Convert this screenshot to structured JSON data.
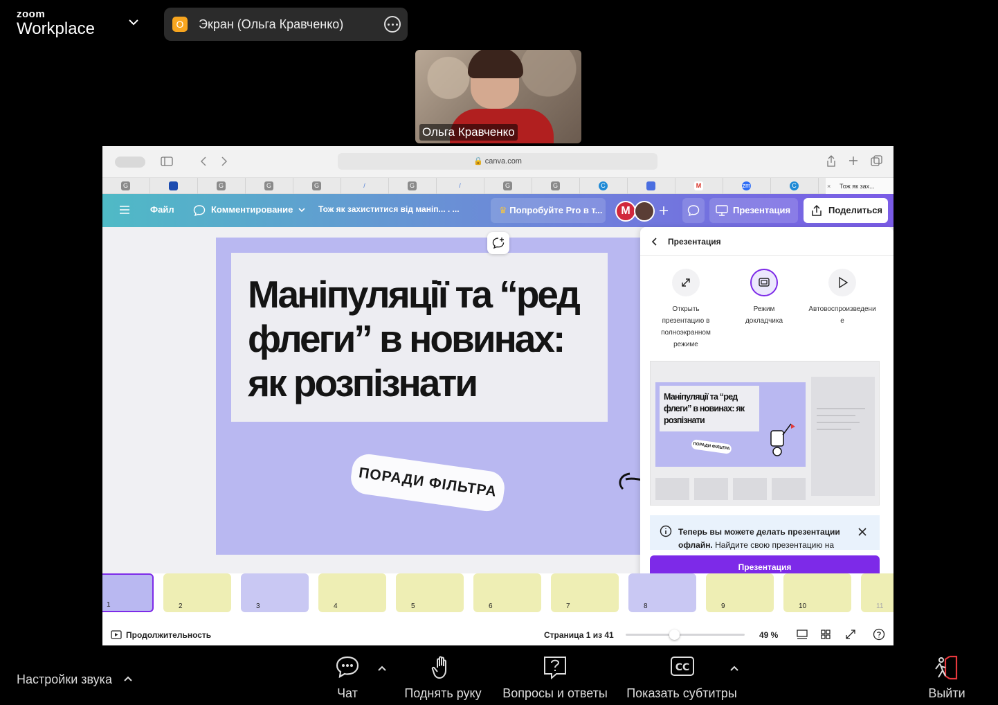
{
  "zoom": {
    "brand_small": "zoom",
    "brand_big": "Workplace",
    "share_badge": "O",
    "share_label": "Экран (Ольга Кравченко)",
    "participant_name": "Ольга Кравченко"
  },
  "browser": {
    "url": "canva.com",
    "tabs": [
      "G",
      "",
      "G",
      "G",
      "G",
      "/",
      "G",
      "/",
      "G",
      "G",
      "C",
      "",
      "M",
      "zm",
      "C"
    ],
    "last_tab_title": "Тож як зах..."
  },
  "canva": {
    "menu_file": "Файл",
    "commenting": "Комментирование",
    "doc_title": "Тож як захиститися від маніп... . ...",
    "pro_promo": "Попробуйте Pro в т...",
    "avatar_letter": "M",
    "present_button": "Презентация",
    "share_button": "Поделиться",
    "slide": {
      "title": "Маніпуляції та “ред флеги” в новинах: як розпізнати",
      "sticker": "ПОРАДИ ФІЛЬТРА"
    },
    "panel": {
      "header": "Презентация",
      "options": [
        {
          "label": "Открыть презентацию в полноэкранном режиме"
        },
        {
          "label": "Режим докладчика"
        },
        {
          "label": "Автовоспроизведение"
        }
      ],
      "preview_title": "Маніпуляції та “ред флеги” в новинах: як розпізнати",
      "preview_sticker": "ПОРАДИ ФІЛЬТРА",
      "notice_bold": "Теперь вы можете делать презентации офлайн.",
      "notice_rest": " Найдите свою презентацию на",
      "button": "Презентация"
    },
    "thumbnails": [
      "1",
      "2",
      "3",
      "4",
      "5",
      "6",
      "7",
      "8",
      "9",
      "10",
      "11"
    ],
    "footer": {
      "duration": "Продолжительность",
      "page": "Страница 1 из 41",
      "zoom": "49 %"
    }
  },
  "bottom_bar": {
    "audio": "Настройки звука",
    "chat": "Чат",
    "raise_hand": "Поднять руку",
    "qa": "Вопросы и ответы",
    "captions": "Показать субтитры",
    "leave": "Выйти"
  }
}
